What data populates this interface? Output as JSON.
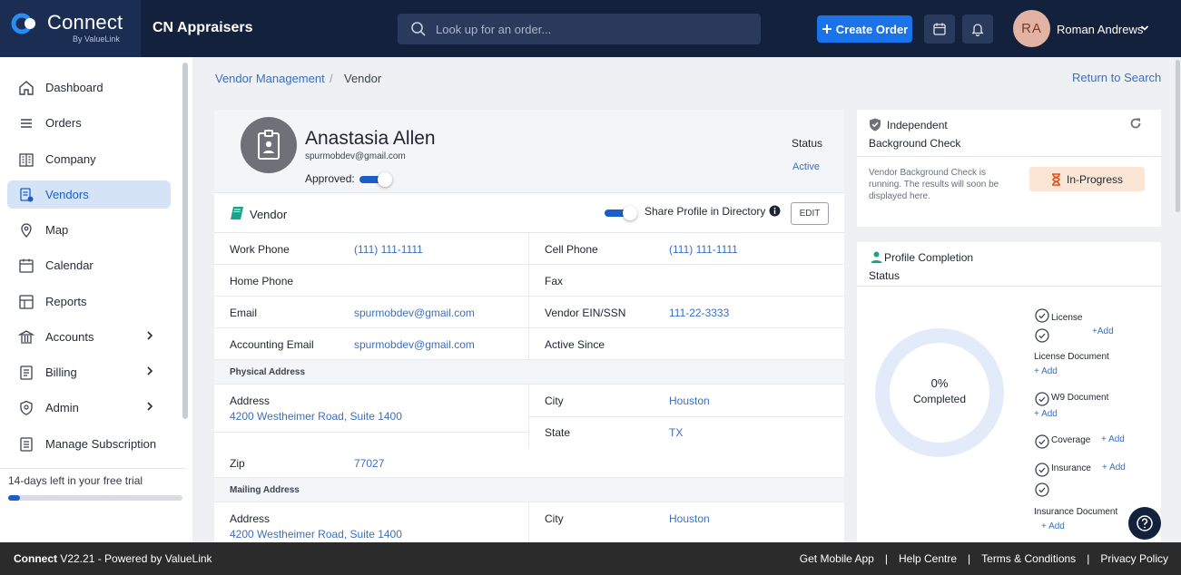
{
  "brand": {
    "name": "Connect",
    "sub": "By ValueLink",
    "org": "CN Appraisers"
  },
  "search": {
    "placeholder": "Look up for an order..."
  },
  "header": {
    "create_label": "Create Order",
    "avatar_initials": "RA",
    "user_name": "Roman Andrews"
  },
  "sidebar": {
    "items": [
      {
        "label": "Dashboard",
        "icon": "home-icon"
      },
      {
        "label": "Orders",
        "icon": "list-icon"
      },
      {
        "label": "Company",
        "icon": "building-icon"
      },
      {
        "label": "Vendors",
        "icon": "vendor-icon",
        "active": true
      },
      {
        "label": "Map",
        "icon": "map-pin-icon"
      },
      {
        "label": "Calendar",
        "icon": "calendar-icon"
      },
      {
        "label": "Reports",
        "icon": "reports-icon"
      },
      {
        "label": "Accounts",
        "icon": "bank-icon",
        "chevron": true
      },
      {
        "label": "Billing",
        "icon": "billing-icon",
        "chevron": true
      },
      {
        "label": "Admin",
        "icon": "admin-icon",
        "chevron": true
      },
      {
        "label": "Manage Subscription",
        "icon": "subscription-icon"
      }
    ],
    "trial_text": "14-days left in your free trial",
    "trial_progress": 0.07
  },
  "breadcrumb": {
    "parent": "Vendor Management",
    "sep": "/",
    "current": "Vendor"
  },
  "return_label": "Return to Search",
  "profile": {
    "name": "Anastasia Allen",
    "email": "spurmobdev@gmail.com",
    "approved_label": "Approved:",
    "status_label": "Status",
    "status_value": "Active"
  },
  "vendor_bar": {
    "title": "Vendor",
    "share_label": "Share Profile in Directory",
    "edit_label": "EDIT"
  },
  "fields": {
    "work_phone_label": "Work Phone",
    "work_phone": "(111) 111-1111",
    "cell_phone_label": "Cell Phone",
    "cell_phone": "(111) 111-1111",
    "home_phone_label": "Home Phone",
    "fax_label": "Fax",
    "email_label": "Email",
    "email": "spurmobdev@gmail.com",
    "ein_label": "Vendor EIN/SSN",
    "ein": "111-22-3333",
    "acct_email_label": "Accounting Email",
    "acct_email": "spurmobdev@gmail.com",
    "active_since_label": "Active Since"
  },
  "physical": {
    "heading": "Physical Address",
    "address_label": "Address",
    "address": "4200 Westheimer Road, Suite 1400",
    "city_label": "City",
    "city": "Houston",
    "state_label": "State",
    "state": "TX",
    "zip_label": "Zip",
    "zip": "77027"
  },
  "mailing": {
    "heading": "Mailing Address",
    "address_label": "Address",
    "address": "4200 Westheimer Road, Suite 1400",
    "city_label": "City",
    "city": "Houston"
  },
  "background_check": {
    "title_line1": "Independent",
    "title_line2": "Background Check",
    "desc": "Vendor Background Check is running. The results will soon be displayed here.",
    "badge": "In-Progress"
  },
  "profile_completion": {
    "title_line1": "Profile Completion",
    "title_line2": "Status",
    "percent_text": "0%",
    "completed_text": "Completed",
    "percent_value": 0,
    "items": [
      {
        "label": "License",
        "add": "+Add"
      },
      {
        "label": "",
        "add": ""
      },
      {
        "label": "License Document",
        "add": "+ Add"
      },
      {
        "label": "W9 Document",
        "add": "+ Add"
      },
      {
        "label": "Coverage",
        "add": "+ Add"
      },
      {
        "label": "Insurance",
        "add": "+ Add"
      },
      {
        "label": "",
        "add": ""
      },
      {
        "label": "Insurance Document",
        "add": "+ Add"
      }
    ]
  },
  "footer": {
    "brand": "Connect",
    "version": " V22.21 - Powered by ValueLink",
    "links": [
      "Get Mobile App",
      "Help Centre",
      "Terms & Conditions",
      "Privacy Policy"
    ]
  },
  "colors": {
    "topbar": "#13213c",
    "accent": "#1a73e8",
    "link": "#3a6fc2",
    "active_nav": "#d5e3f7"
  }
}
